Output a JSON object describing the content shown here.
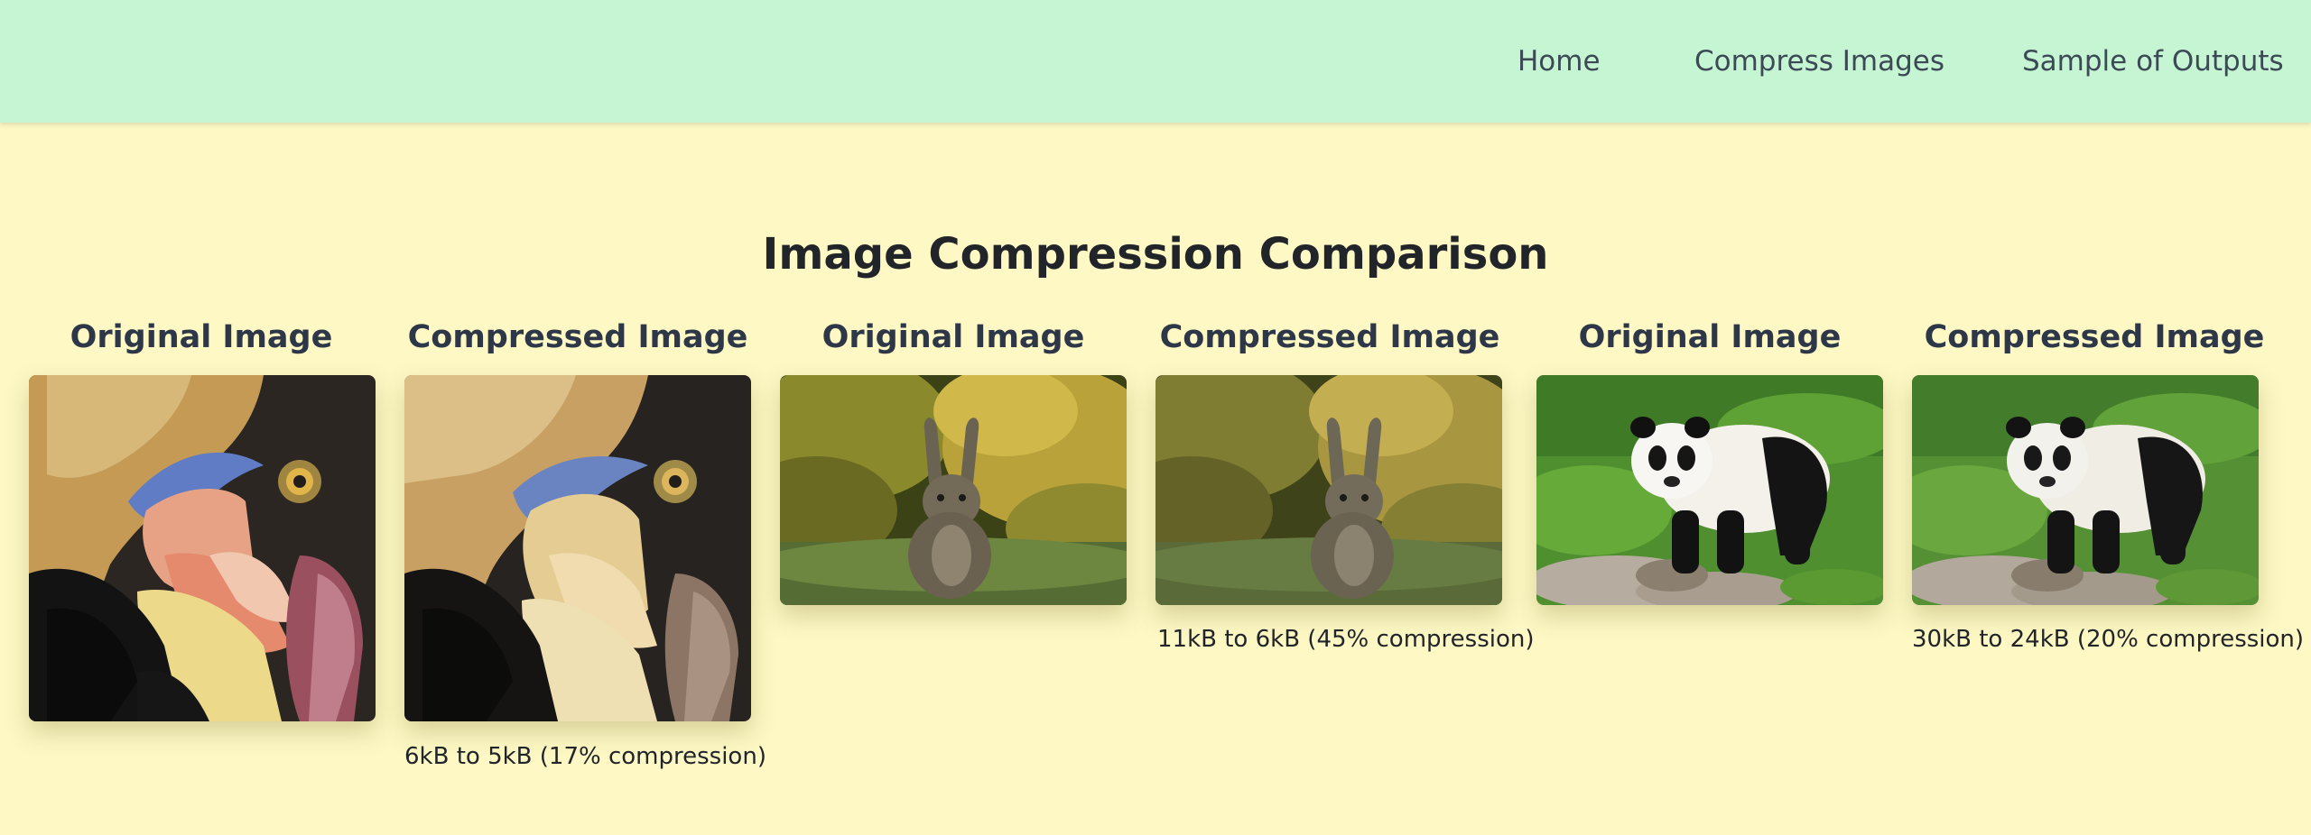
{
  "nav": {
    "home": "Home",
    "compress": "Compress Images",
    "samples": "Sample of Outputs"
  },
  "page_title": "Image Compression Comparison",
  "pairs": [
    {
      "original_label": "Original Image",
      "compressed_label": "Compressed Image",
      "subject": "bird",
      "caption": "6kB to 5kB (17% compression)"
    },
    {
      "original_label": "Original Image",
      "compressed_label": "Compressed Image",
      "subject": "rabbit",
      "caption": "11kB to 6kB (45% compression)"
    },
    {
      "original_label": "Original Image",
      "compressed_label": "Compressed Image",
      "subject": "panda",
      "caption": "30kB to 24kB (20% compression)"
    }
  ]
}
